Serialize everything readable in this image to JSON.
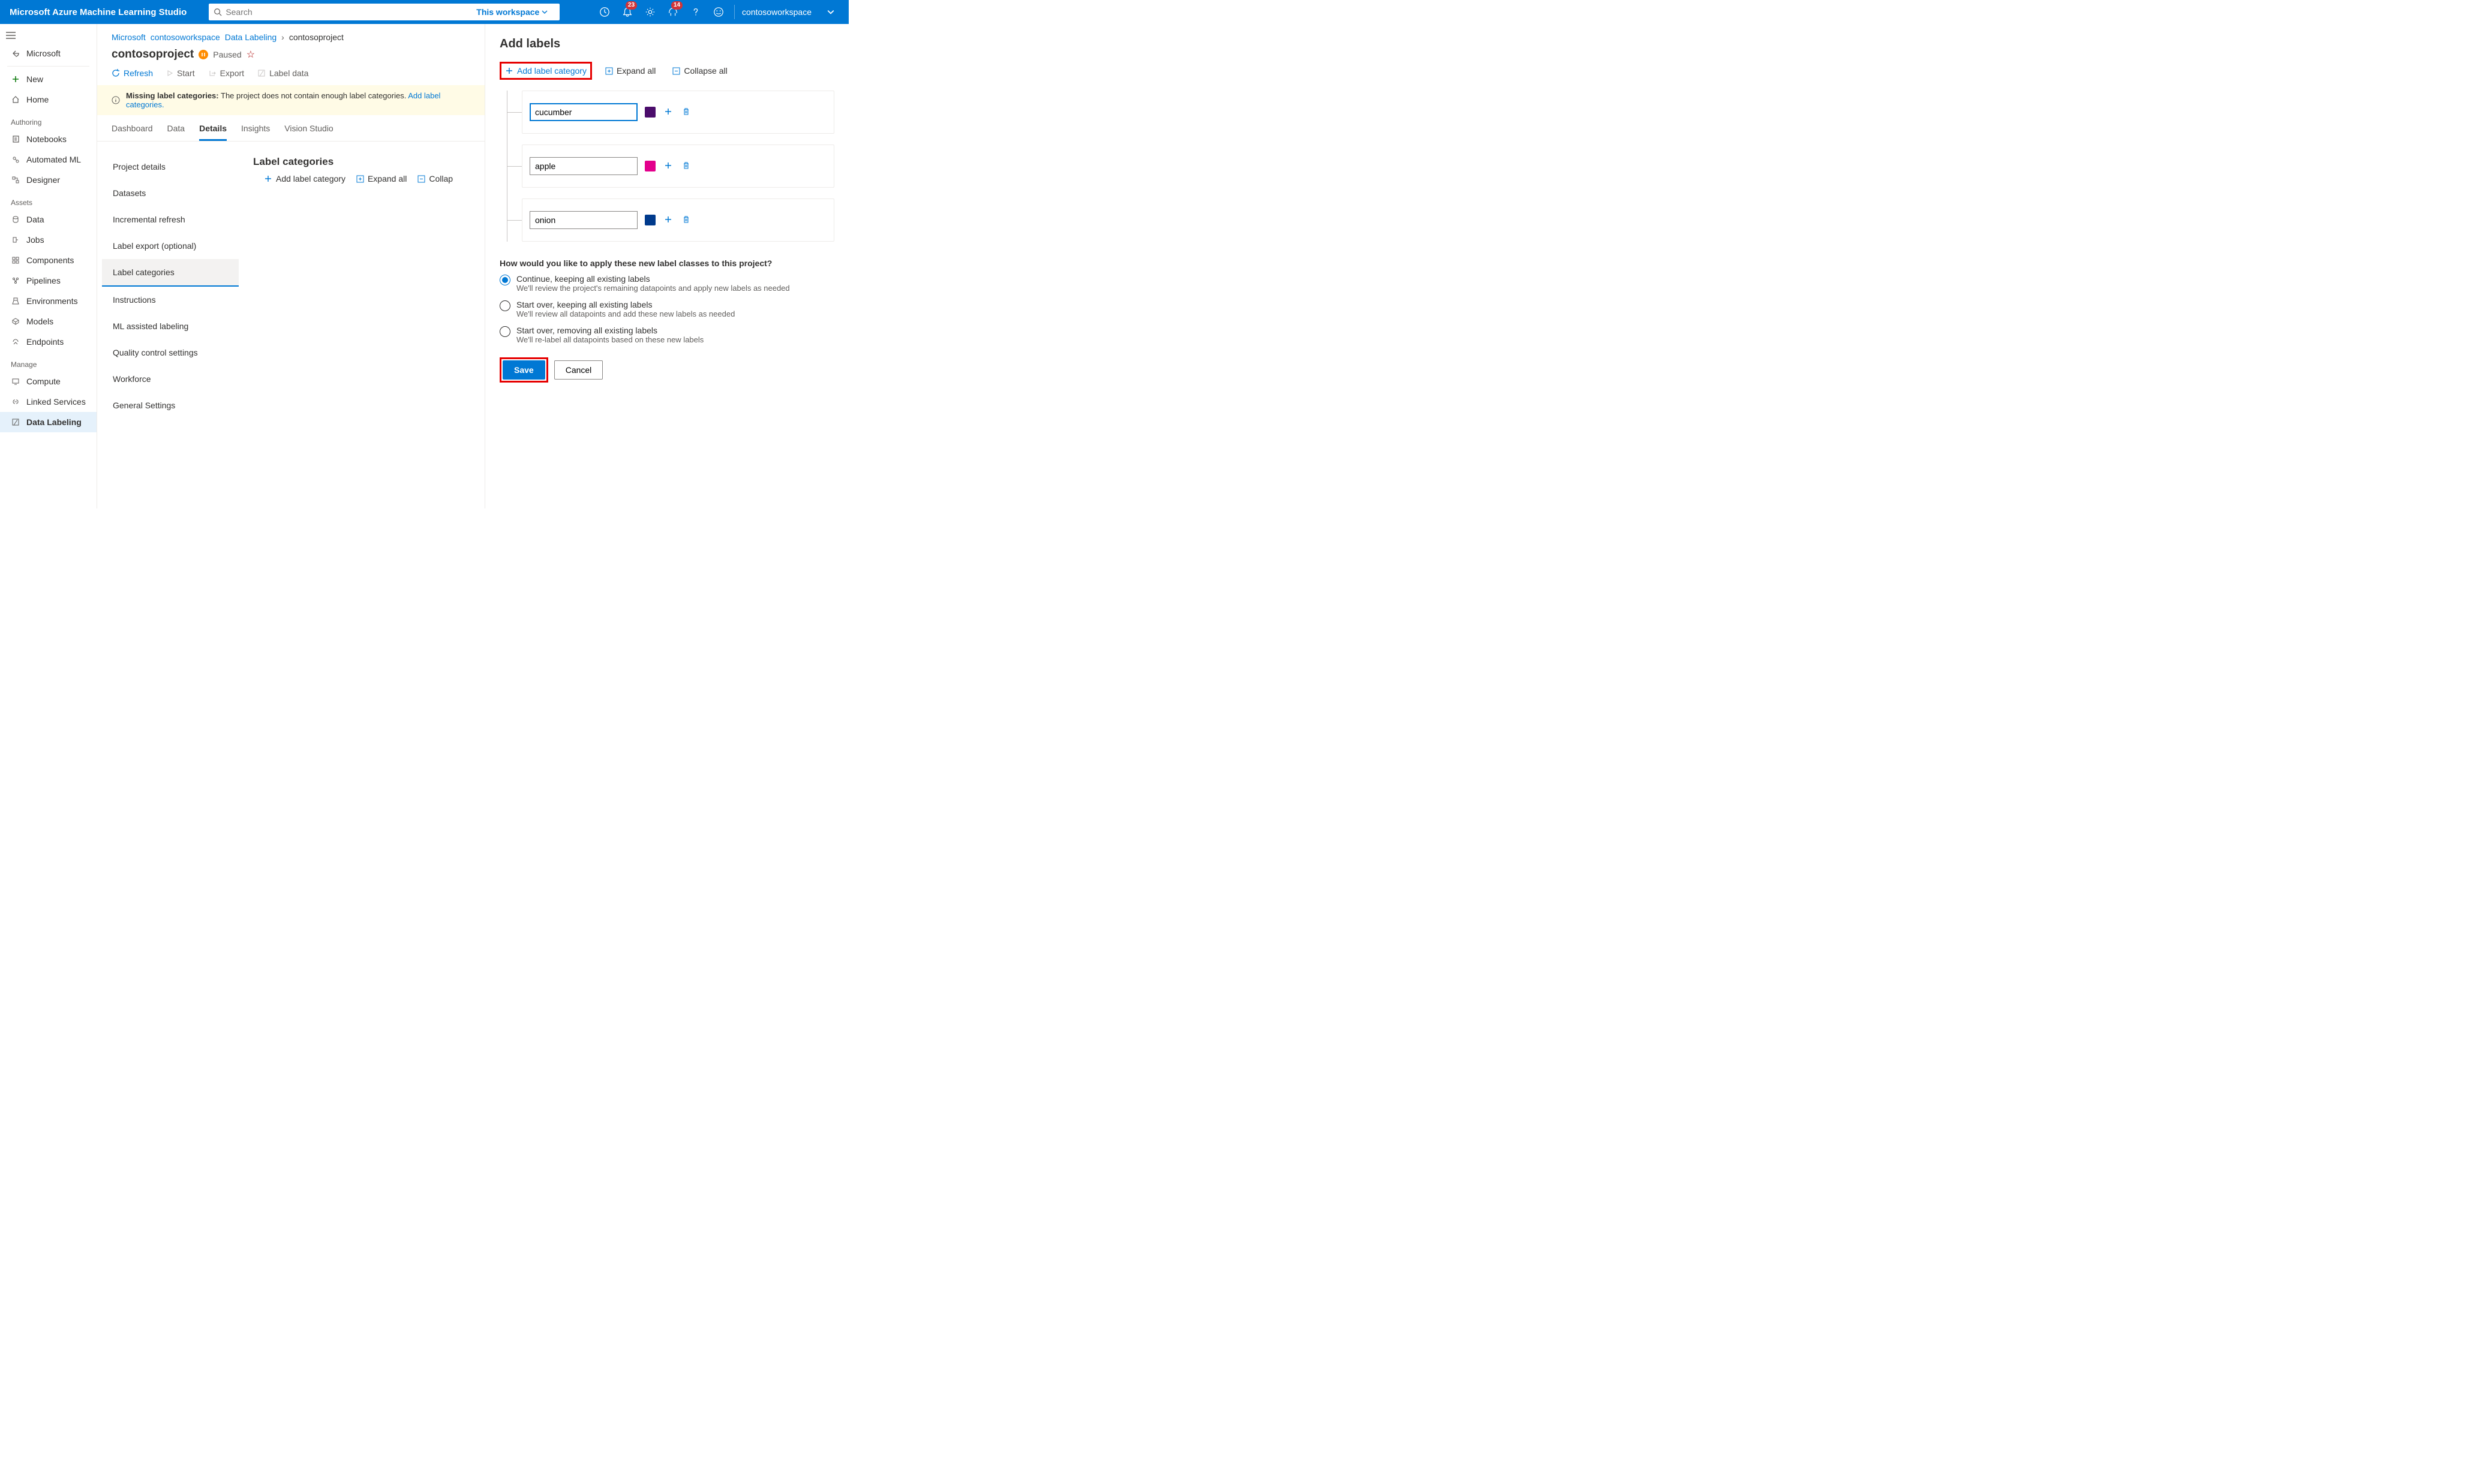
{
  "top": {
    "brand": "Microsoft Azure Machine Learning Studio",
    "searchPlaceholder": "Search",
    "scope": "This workspace",
    "badges": {
      "bell": "23",
      "diag": "14"
    },
    "workspace": "contosoworkspace"
  },
  "nav": {
    "back": "Microsoft",
    "new": "New",
    "home": "Home",
    "sections": {
      "authoring": "Authoring",
      "assets": "Assets",
      "manage": "Manage"
    },
    "notebooks": "Notebooks",
    "automl": "Automated ML",
    "designer": "Designer",
    "data": "Data",
    "jobs": "Jobs",
    "components": "Components",
    "pipelines": "Pipelines",
    "environments": "Environments",
    "models": "Models",
    "endpoints": "Endpoints",
    "compute": "Compute",
    "linked": "Linked Services",
    "labeling": "Data Labeling"
  },
  "crumbs": {
    "a": "Microsoft",
    "b": "contosoworkspace",
    "c": "Data Labeling",
    "d": "contosoproject"
  },
  "project": {
    "name": "contosoproject",
    "status": "Paused"
  },
  "actions": {
    "refresh": "Refresh",
    "start": "Start",
    "export": "Export",
    "label": "Label data"
  },
  "banner": {
    "prefix": "Missing label categories:",
    "body": "The project does not contain enough label categories.",
    "link": "Add label categories."
  },
  "tabs": {
    "dashboard": "Dashboard",
    "data": "Data",
    "details": "Details",
    "insights": "Insights",
    "vision": "Vision Studio"
  },
  "inner": {
    "project": "Project details",
    "datasets": "Datasets",
    "incremental": "Incremental refresh",
    "export": "Label export (optional)",
    "categories": "Label categories",
    "instructions": "Instructions",
    "ml": "ML assisted labeling",
    "qc": "Quality control settings",
    "workforce": "Workforce",
    "general": "General Settings"
  },
  "lc": {
    "title": "Label categories",
    "add": "Add label category",
    "expand": "Expand all",
    "collapse": "Collap"
  },
  "flyout": {
    "title": "Add labels",
    "add": "Add label category",
    "expand": "Expand all",
    "collapse": "Collapse all",
    "labels": [
      {
        "name": "cucumber",
        "color": "#4b0d6b"
      },
      {
        "name": "apple",
        "color": "#e3008c"
      },
      {
        "name": "onion",
        "color": "#003a8c"
      }
    ],
    "question": "How would you like to apply these new label classes to this project?",
    "radios": [
      {
        "title": "Continue, keeping all existing labels",
        "sub": "We'll review the project's remaining datapoints and apply new labels as needed",
        "checked": true
      },
      {
        "title": "Start over, keeping all existing labels",
        "sub": "We'll review all datapoints and add these new labels as needed",
        "checked": false
      },
      {
        "title": "Start over, removing all existing labels",
        "sub": "We'll re-label all datapoints based on these new labels",
        "checked": false
      }
    ],
    "save": "Save",
    "cancel": "Cancel"
  }
}
